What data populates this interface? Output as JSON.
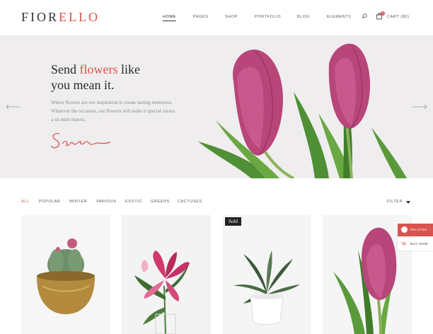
{
  "brand": {
    "logo_main": "FIOR",
    "logo_accent": "ELLO"
  },
  "nav": {
    "items": [
      "HOME",
      "PAGES",
      "SHOP",
      "PORTFOLIO",
      "BLOG",
      "ELEMENTS"
    ],
    "active": "HOME"
  },
  "cart": {
    "label": "CART ($0)",
    "count": "0"
  },
  "hero": {
    "title_pre": "Send ",
    "title_accent": "flowers",
    "title_post": " like",
    "title_line2": "you mean it.",
    "text": "Where flowers are our inspiration to create lasting memories. Whatever the occasion, our flowers will make it special cursus a sit amet mauris.",
    "signature": "Sara"
  },
  "filters": {
    "items": [
      "ALL",
      "POPULAR",
      "WINTER",
      "VARIOUS",
      "EXOTIC",
      "GREENS",
      "CACTUSES"
    ],
    "active": "ALL",
    "filter_label": "FILTER"
  },
  "products": {
    "badge": "Sold"
  },
  "side": {
    "related": "RELATED",
    "buy": "BUY NOW"
  },
  "colors": {
    "accent": "#d9534f",
    "hero_bg": "#efeded",
    "tulip": "#b8467a",
    "stem": "#5c9a3c"
  },
  "icons": [
    "search-icon",
    "cart-icon",
    "arrow-left-icon",
    "arrow-right-icon",
    "caret-down-icon"
  ]
}
